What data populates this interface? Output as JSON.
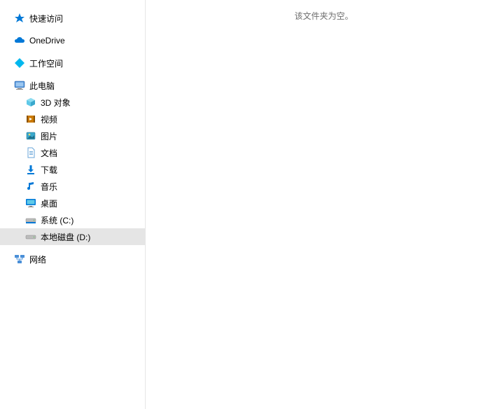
{
  "sidebar": {
    "quick_access": "快速访问",
    "onedrive": "OneDrive",
    "workspace": "工作空间",
    "this_pc": "此电脑",
    "this_pc_children": {
      "objects3d": "3D 对象",
      "videos": "视频",
      "pictures": "图片",
      "documents": "文档",
      "downloads": "下载",
      "music": "音乐",
      "desktop": "桌面",
      "system_drive": "系统 (C:)",
      "data_drive": "本地磁盘 (D:)"
    },
    "network": "网络"
  },
  "main": {
    "empty_message": "该文件夹为空。"
  }
}
